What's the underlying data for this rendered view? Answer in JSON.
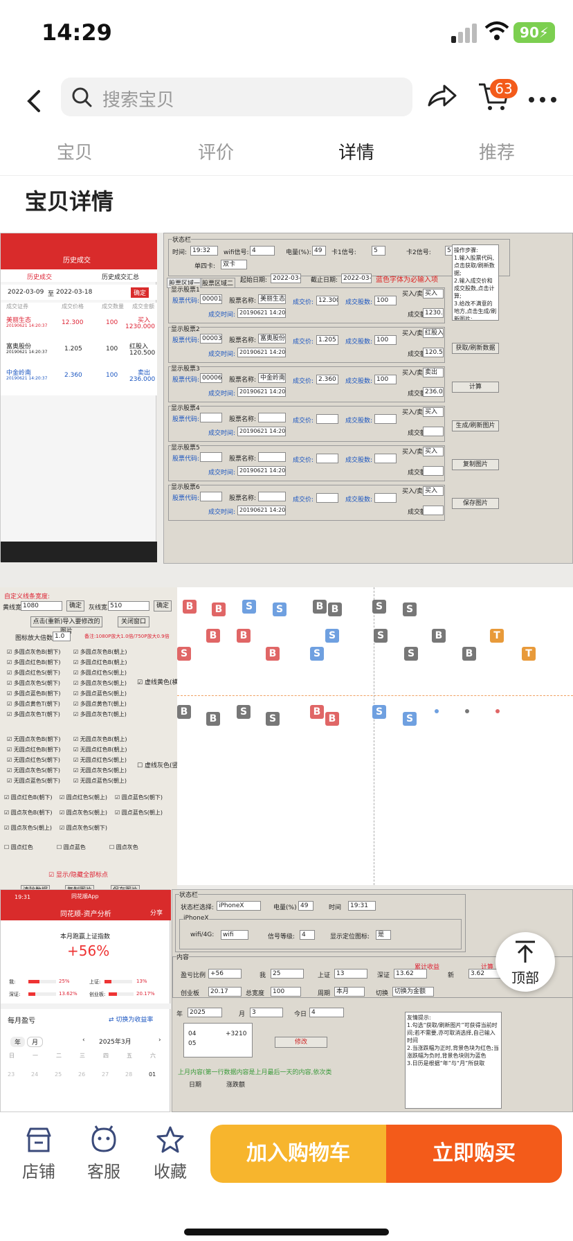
{
  "status": {
    "time": "14:29",
    "battery": "90"
  },
  "nav": {
    "search_placeholder": "搜索宝贝",
    "cart_count": "63"
  },
  "tabs": [
    "宝贝",
    "评价",
    "详情",
    "推荐"
  ],
  "section_title": "宝贝详情",
  "panel1": {
    "phone_header": "历史成交",
    "tab_a": "历史成交",
    "tab_b": "历史成交汇总",
    "date_from": "2022-03-09",
    "to": "至",
    "date_to": "2022-03-18",
    "confirm": "确定",
    "col1": "成交证券",
    "col2": "成交价格",
    "col3": "成交数量",
    "col4": "成交金额",
    "rows": [
      {
        "name": "美丽生态",
        "time": "20190621 14:20:37",
        "price": "12.300",
        "qty": "100",
        "side": "买入",
        "amount": "1230.000"
      },
      {
        "name": "富奥股份",
        "time": "20190621 14:20:37",
        "price": "1.205",
        "qty": "100",
        "side": "红股入",
        "amount": "120.500"
      },
      {
        "name": "中金岭南",
        "time": "20190621 14:20:37",
        "price": "2.360",
        "qty": "100",
        "side": "卖出",
        "amount": "236.000"
      }
    ]
  },
  "panel2": {
    "status_group": "状态栏",
    "time_label": "时间:",
    "time_value": "19:32",
    "wifi_label": "wifi信号:",
    "wifi_value": "4",
    "battery_label": "电量(%):",
    "battery_value": "49",
    "sim1_label": "卡1信号:",
    "sim1_value": "5",
    "sim2_label": "卡2信号:",
    "sim2_value": "5",
    "sim_mode_label": "单四卡:",
    "sim_mode_value": "双卡",
    "tab_a": "股票区域一",
    "tab_b": "股票区域二",
    "start_label": "起始日期:",
    "start_value": "2022-03-09",
    "end_label": "截止日期:",
    "end_value": "2022-03-18",
    "hint": "蓝色字体为必输入项",
    "stocks": [
      {
        "title": "显示股票1",
        "code": "000010",
        "name": "美丽生态",
        "price": "12.300",
        "qty": "100",
        "side": "买入",
        "amount": "1230.000",
        "time": "20190621 14:20:37"
      },
      {
        "title": "显示股票2",
        "code": "000030",
        "name": "富奥股份",
        "price": "1.205",
        "qty": "100",
        "side": "红股入",
        "amount": "120.500",
        "time": "20190621 14:20:37"
      },
      {
        "title": "显示股票3",
        "code": "000060",
        "name": "中金岭南",
        "price": "2.360",
        "qty": "100",
        "side": "卖出",
        "amount": "236.000",
        "time": "20190621 14:20:37"
      },
      {
        "title": "显示股票4",
        "code": "",
        "name": "",
        "price": "",
        "qty": "",
        "side": "买入",
        "amount": "",
        "time": "20190621 14:20:37"
      },
      {
        "title": "显示股票5",
        "code": "",
        "name": "",
        "price": "",
        "qty": "",
        "side": "买入",
        "amount": "",
        "time": "20190621 14:20:37"
      },
      {
        "title": "显示股票6",
        "code": "",
        "name": "",
        "price": "",
        "qty": "",
        "side": "买入",
        "amount": "",
        "time": "20190621 14:20:37"
      }
    ],
    "labels": {
      "code": "股票代码:",
      "name": "股票名称:",
      "price": "成交价:",
      "qty": "成交股数:",
      "side": "买入/卖出:",
      "amount": "成交额:",
      "time": "成交时间:"
    },
    "steps": "操作步骤:\n1.输入股票代码,点击获取/刷新数据;\n2.输入成交价和成交股数,点击计算;\n3.给改不满意的地方,点击生成/刷新图片;\n4.点击复制或者",
    "buttons": [
      "获取/刷新数据",
      "计算",
      "生成/刷新图片",
      "复制图片",
      "保存图片"
    ]
  },
  "panel3": {
    "title": "自定义线条宽度:",
    "line_width_label": "黄线宽",
    "line_width_value": "1080",
    "confirm": "确定",
    "gray_width_label": "灰线宽",
    "gray_width_value": "510",
    "import_btn": "点击(重新)导入要修改的图片",
    "close_btn": "关闭窗口",
    "scale_label": "图标放大倍数:",
    "scale_value": "1.0",
    "scale_note": "备注:1080P放大1.0倍/750P放大0.9倍",
    "opts_left": [
      "多圆点灰色B(朝下)",
      "多圆点红色B(朝下)",
      "多圆点红色S(朝下)",
      "多圆点灰色S(朝下)",
      "多圆点蓝色B(朝下)",
      "多圆点黄色T(朝下)",
      "多圆点灰色T(朝下)"
    ],
    "opts_right": [
      "多圆点灰色B(朝上)",
      "多圆点红色B(朝上)",
      "多圆点红色S(朝上)",
      "多圆点灰色S(朝上)",
      "多圆点蓝色S(朝上)",
      "多圆点黄色T(朝上)",
      "多圆点灰色T(朝上)"
    ],
    "virtual_yellow": "虚线黄色(横)",
    "opts2_left": [
      "无圆点灰色B(朝下)",
      "无圆点红色B(朝下)",
      "无圆点红色S(朝下)",
      "无圆点灰色S(朝下)",
      "无圆点蓝色S(朝下)"
    ],
    "opts2_right": [
      "无圆点灰色B(朝上)",
      "无圆点红色B(朝上)",
      "无圆点红色S(朝上)",
      "无圆点灰色S(朝上)",
      "无圆点蓝色S(朝上)"
    ],
    "virtual_gray": "虚线灰色(竖)",
    "opts3": [
      "圆点红色B(朝下)",
      "圆点红色S(朝上)",
      "圆点蓝色S(朝下)",
      "圆点灰色B(朝下)",
      "圆点灰色S(朝上)",
      "圆点蓝色S(朝上)",
      "圆点灰色S(朝上)",
      "圆点灰色S(朝下)"
    ],
    "opts4": [
      "圆点红色",
      "圆点蓝色",
      "圆点灰色"
    ],
    "show_all": "显示/隐藏全部标点",
    "btns": [
      "清除数据",
      "复制图片",
      "保存图片"
    ]
  },
  "panel4": {
    "time": "19:31",
    "app": "同花顺App",
    "header": "同花顺-资产分析",
    "share": "分享",
    "sub": "本月跑赢上证指数",
    "pct": "+56%",
    "me_label": "我:",
    "me_value": "25%",
    "sh_label": "上证:",
    "sh_value": "13%",
    "sz_label": "深证:",
    "sz_value": "13.62%",
    "cy_label": "创业板:",
    "cy_value": "20.17%",
    "monthly": "每月盈亏",
    "switch": "切换为收益率",
    "year": "年",
    "month": "月",
    "cal_month": "2025年3月",
    "weekdays": [
      "日",
      "一",
      "二",
      "三",
      "四",
      "五",
      "六"
    ],
    "days": [
      "23",
      "24",
      "25",
      "26",
      "27",
      "28",
      "01"
    ]
  },
  "panel5": {
    "status_group": "状态栏",
    "select_label": "状态栏选择:",
    "select_value": "iPhoneX",
    "battery_label": "电量(%)",
    "battery_value": "49",
    "time_label": "时间",
    "time_value": "19:31",
    "iphone_group": "iPhoneX",
    "net_label": "wifi/4G:",
    "net_value": "wifi",
    "signal_label": "信号等级:",
    "signal_value": "4",
    "loc_label": "显示定位图标:",
    "loc_value": "是",
    "content_group": "内容",
    "ratio_label": "盈亏比例",
    "ratio_value": "+56",
    "me_label": "我",
    "me_value": "25",
    "sh_label": "上证",
    "sh_value": "13",
    "sz_label": "深证",
    "sz_value": "13.62",
    "cy_label": "创业板",
    "cy_value": "20.17",
    "total_label": "总宽度",
    "total_value": "100",
    "period_label": "周期",
    "period_value": "本月",
    "switch_label": "切换",
    "switch_value": "切换为金额",
    "accum": "累计收益",
    "calc": "计算",
    "new_label": "新",
    "new_value": "3.62",
    "year_label": "年",
    "year_value": "2025",
    "month_label": "月",
    "month_value": "3",
    "today_label": "今日",
    "today_value": "4",
    "list": [
      [
        "04",
        "+3210"
      ],
      [
        "05",
        ""
      ]
    ],
    "modify": "修改",
    "tips": "友情提示:\n1.勾选“获取/刷新图片”可获得当前时间;若不需要,亦可取消选择,自己输入时间\n2.当涨跌幅为正时,背景色块为红色;当涨跌幅为负时,背景色块则为蓝色\n3.日历是根据“年”与“月”所获取",
    "last_month": "上月内容(第一行数据内容是上月最后一天的内容,依次类",
    "date_col": "日期",
    "pnl_col": "涨跌额"
  },
  "to_top": "顶部",
  "bottom": {
    "shop": "店铺",
    "service": "客服",
    "favorite": "收藏",
    "add_cart": "加入购物车",
    "buy_now": "立即购买"
  }
}
